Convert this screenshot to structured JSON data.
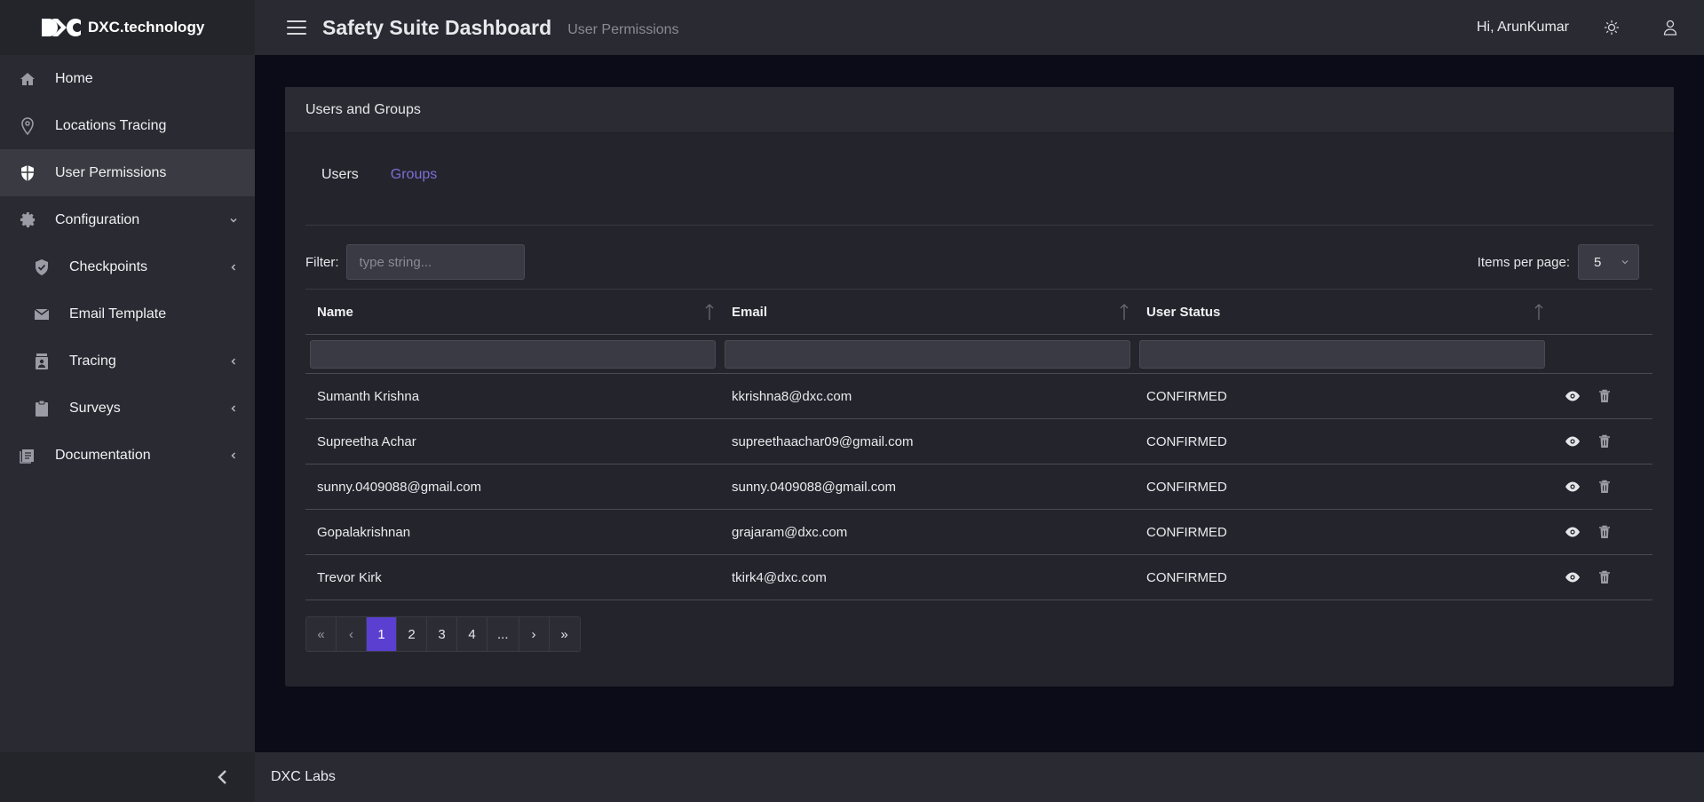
{
  "brand": {
    "name": "DXC.technology"
  },
  "sidebar": {
    "items": [
      {
        "label": "Home",
        "icon": "home-icon"
      },
      {
        "label": "Locations Tracing",
        "icon": "location-pin-icon"
      },
      {
        "label": "User Permissions",
        "icon": "shield-icon",
        "active": true
      },
      {
        "label": "Configuration",
        "icon": "gear-icon",
        "expanded": true
      },
      {
        "label": "Checkpoints",
        "icon": "shield-check-icon",
        "sub": true
      },
      {
        "label": "Email Template",
        "icon": "envelope-icon",
        "sub": true
      },
      {
        "label": "Tracing",
        "icon": "tracing-icon",
        "sub": true
      },
      {
        "label": "Surveys",
        "icon": "clipboard-icon",
        "sub": true
      },
      {
        "label": "Documentation",
        "icon": "document-icon"
      }
    ]
  },
  "header": {
    "title": "Safety Suite Dashboard",
    "subtitle": "User Permissions",
    "greeting": "Hi, ArunKumar"
  },
  "card": {
    "title": "Users and Groups",
    "tabs": [
      "Users",
      "Groups"
    ],
    "filter_label": "Filter:",
    "filter_placeholder": "type string...",
    "items_per_page_label": "Items per page:",
    "items_per_page_value": "5",
    "columns": [
      "Name",
      "Email",
      "User Status"
    ],
    "rows": [
      {
        "name": "Sumanth Krishna",
        "email": "kkrishna8@dxc.com",
        "status": "CONFIRMED"
      },
      {
        "name": "Supreetha Achar",
        "email": "supreethaachar09@gmail.com",
        "status": "CONFIRMED"
      },
      {
        "name": "sunny.0409088@gmail.com",
        "email": "sunny.0409088@gmail.com",
        "status": "CONFIRMED"
      },
      {
        "name": "Gopalakrishnan",
        "email": "grajaram@dxc.com",
        "status": "CONFIRMED"
      },
      {
        "name": "Trevor Kirk",
        "email": "tkirk4@dxc.com",
        "status": "CONFIRMED"
      }
    ],
    "pagination": [
      "«",
      "‹",
      "1",
      "2",
      "3",
      "4",
      "...",
      "›",
      "»"
    ],
    "current_page": "1"
  },
  "footer": {
    "text": "DXC Labs"
  },
  "colors": {
    "accent": "#5b3fd0",
    "tab_selected": "#7f6ed8",
    "background": "#0b0c17"
  }
}
